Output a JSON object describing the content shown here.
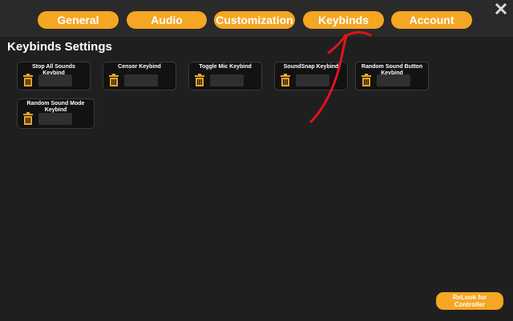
{
  "tabs": {
    "general": "General",
    "audio": "Audio",
    "customization": "Customization",
    "keybinds": "Keybinds",
    "account": "Account"
  },
  "page_title": "Keybinds Settings",
  "keybinds": [
    {
      "label": "Stop All Sounds Keybind",
      "value": ""
    },
    {
      "label": "Censor Keybind",
      "value": ""
    },
    {
      "label": "Toggle Mic Keybind",
      "value": ""
    },
    {
      "label": "SoundSnap Keybind",
      "value": ""
    },
    {
      "label": "Random Sound Button Keybind",
      "value": ""
    },
    {
      "label": "Random Sound Mode Keybind",
      "value": ""
    }
  ],
  "relook_button": "ReLook for Controller",
  "icons": {
    "close": "close-icon",
    "trash": "trash-icon"
  },
  "colors": {
    "accent": "#f5a623",
    "annotation": "#e0141a"
  }
}
